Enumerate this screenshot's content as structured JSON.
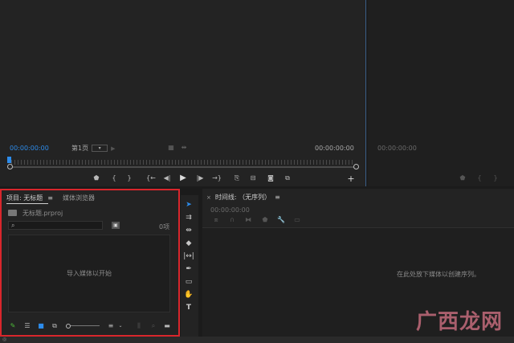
{
  "program_monitor": {
    "timecode_in": "00:00:00:00",
    "page_select": "第1页",
    "timecode_out": "00:00:00:00"
  },
  "source_monitor": {
    "timecode": "00:00:00:00"
  },
  "project_panel": {
    "tab_project": "项目: 无标题",
    "tab_media_browser": "媒体浏览器",
    "file_name": "无标题.prproj",
    "search_placeholder": "",
    "item_count": "0项",
    "empty_message": "导入媒体以开始"
  },
  "timeline_panel": {
    "tab_label": "时间线: （无序列）",
    "timecode": "00:00:00:00",
    "empty_message": "在此处放下媒体以创建序列。"
  },
  "watermark": {
    "text": "广西龙网"
  },
  "colors": {
    "accent": "#2d8ceb",
    "highlight_border": "#d9262c"
  }
}
